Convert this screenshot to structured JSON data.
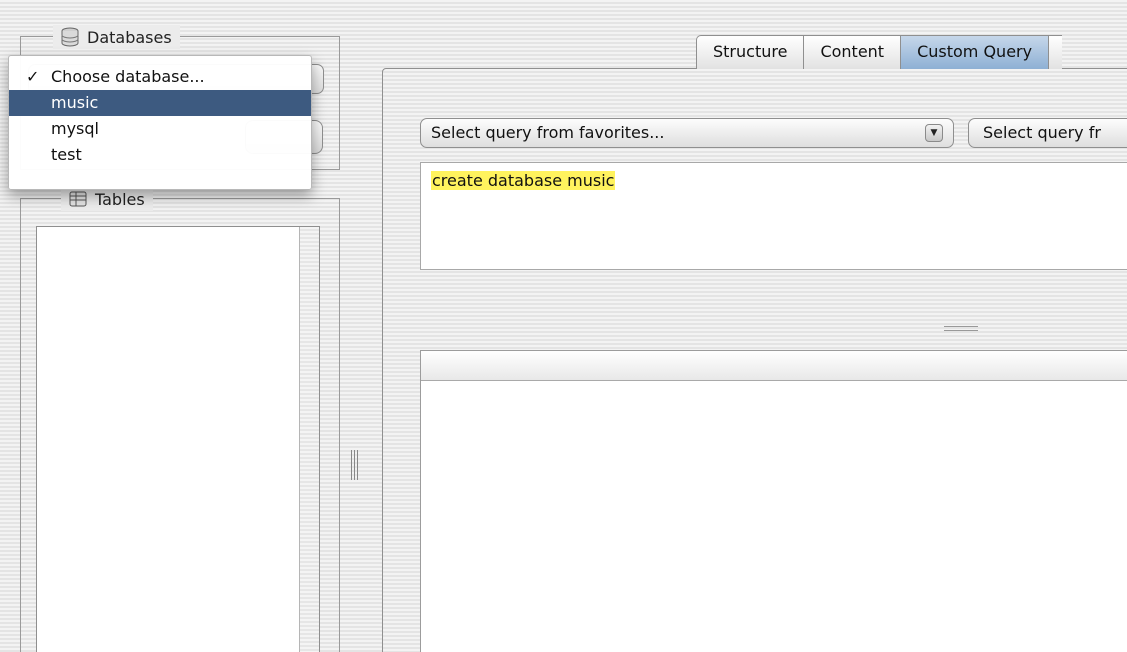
{
  "databases": {
    "label": "Databases",
    "icon": "database-icon",
    "menu": {
      "items": [
        {
          "label": "Choose database...",
          "checked": true,
          "highlighted": false
        },
        {
          "label": "music",
          "checked": false,
          "highlighted": true
        },
        {
          "label": "mysql",
          "checked": false,
          "highlighted": false
        },
        {
          "label": "test",
          "checked": false,
          "highlighted": false
        }
      ],
      "check_mark": "✓"
    }
  },
  "tables": {
    "label": "Tables",
    "icon": "table-icon"
  },
  "tabs": [
    {
      "label": "Structure",
      "active": false
    },
    {
      "label": "Content",
      "active": false
    },
    {
      "label": "Custom Query",
      "active": true
    }
  ],
  "query": {
    "favorites_select": "Select query from favorites...",
    "history_select": "Select query fr",
    "editor_text": "create database music"
  },
  "colors": {
    "menu_highlight": "#3d5a80",
    "query_highlight": "#fff35e",
    "active_tab": "#a9c3e0"
  }
}
